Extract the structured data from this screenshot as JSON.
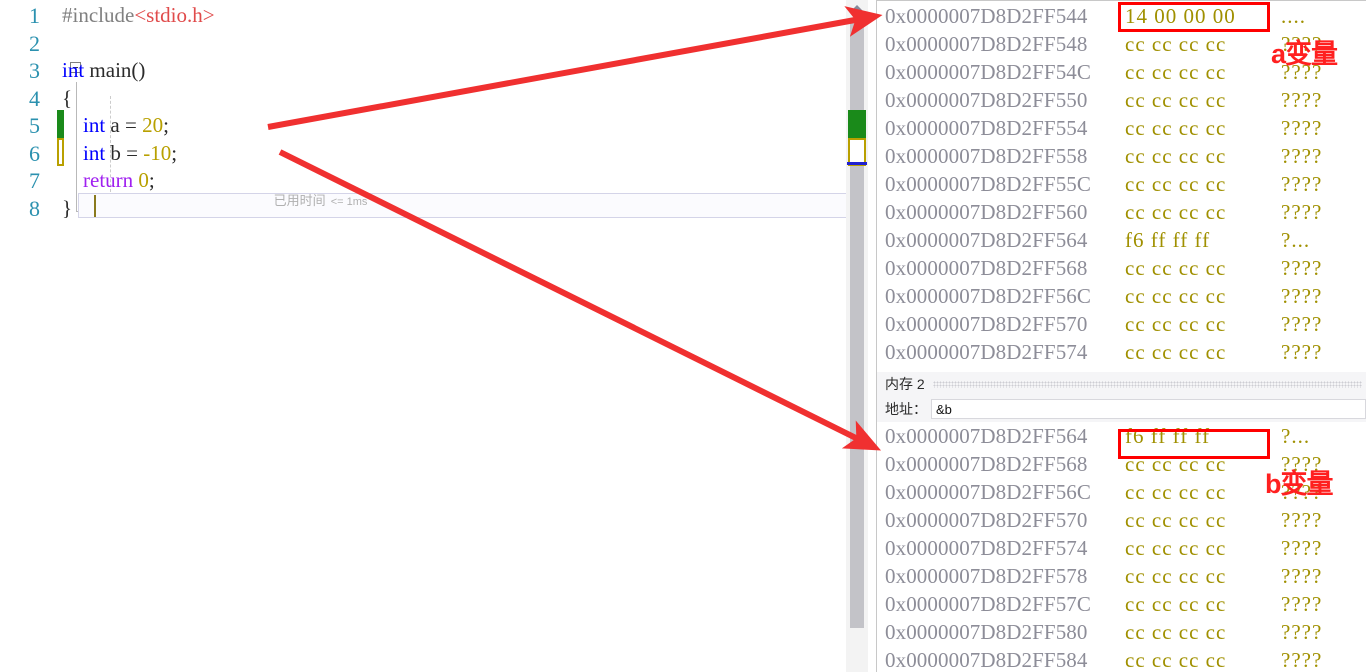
{
  "editor": {
    "elapsed_hint_zh": "已用时间",
    "elapsed_hint_en": "<= 1ms",
    "lines": [
      {
        "no": "1",
        "tokens": [
          {
            "t": "#include",
            "c": "pp"
          },
          {
            "t": "<stdio.h>",
            "c": "str"
          }
        ]
      },
      {
        "no": "2",
        "tokens": []
      },
      {
        "no": "3",
        "tokens": [
          {
            "t": "int",
            "c": "kw"
          },
          {
            "t": " ",
            "c": "plain"
          },
          {
            "t": "main",
            "c": "ident"
          },
          {
            "t": "()",
            "c": "punct"
          }
        ]
      },
      {
        "no": "4",
        "tokens": [
          {
            "t": "{",
            "c": "punct"
          }
        ]
      },
      {
        "no": "5",
        "tokens": [
          {
            "t": "    ",
            "c": "plain"
          },
          {
            "t": "int",
            "c": "kw"
          },
          {
            "t": " ",
            "c": "plain"
          },
          {
            "t": "a",
            "c": "ident"
          },
          {
            "t": " = ",
            "c": "punct"
          },
          {
            "t": "20",
            "c": "num"
          },
          {
            "t": ";",
            "c": "punct"
          }
        ]
      },
      {
        "no": "6",
        "tokens": [
          {
            "t": "    ",
            "c": "plain"
          },
          {
            "t": "int",
            "c": "kw"
          },
          {
            "t": " ",
            "c": "plain"
          },
          {
            "t": "b",
            "c": "ident"
          },
          {
            "t": " = ",
            "c": "punct"
          },
          {
            "t": "-10",
            "c": "num"
          },
          {
            "t": ";",
            "c": "punct"
          }
        ]
      },
      {
        "no": "7",
        "tokens": [
          {
            "t": "    ",
            "c": "plain"
          },
          {
            "t": "return",
            "c": "kw2"
          },
          {
            "t": " ",
            "c": "plain"
          },
          {
            "t": "0",
            "c": "num"
          },
          {
            "t": ";",
            "c": "punct"
          }
        ]
      },
      {
        "no": "8",
        "tokens": [
          {
            "t": "}",
            "c": "punct"
          }
        ]
      }
    ]
  },
  "memory_panel_1": {
    "rows": [
      {
        "addr": "0x0000007D8D2FF544",
        "hex": "14 00 00 00",
        "ascii": "...."
      },
      {
        "addr": "0x0000007D8D2FF548",
        "hex": "cc cc cc cc",
        "ascii": "????"
      },
      {
        "addr": "0x0000007D8D2FF54C",
        "hex": "cc cc cc cc",
        "ascii": "????"
      },
      {
        "addr": "0x0000007D8D2FF550",
        "hex": "cc cc cc cc",
        "ascii": "????"
      },
      {
        "addr": "0x0000007D8D2FF554",
        "hex": "cc cc cc cc",
        "ascii": "????"
      },
      {
        "addr": "0x0000007D8D2FF558",
        "hex": "cc cc cc cc",
        "ascii": "????"
      },
      {
        "addr": "0x0000007D8D2FF55C",
        "hex": "cc cc cc cc",
        "ascii": "????"
      },
      {
        "addr": "0x0000007D8D2FF560",
        "hex": "cc cc cc cc",
        "ascii": "????"
      },
      {
        "addr": "0x0000007D8D2FF564",
        "hex": "f6 ff ff ff",
        "ascii": "?..."
      },
      {
        "addr": "0x0000007D8D2FF568",
        "hex": "cc cc cc cc",
        "ascii": "????"
      },
      {
        "addr": "0x0000007D8D2FF56C",
        "hex": "cc cc cc cc",
        "ascii": "????"
      },
      {
        "addr": "0x0000007D8D2FF570",
        "hex": "cc cc cc cc",
        "ascii": "????"
      },
      {
        "addr": "0x0000007D8D2FF574",
        "hex": "cc cc cc cc",
        "ascii": "????"
      }
    ],
    "annotation": "a变量"
  },
  "memory_panel_2": {
    "title": "内存 2",
    "address_label": "地址：",
    "address_value": "&b",
    "rows": [
      {
        "addr": "0x0000007D8D2FF564",
        "hex": "f6 ff ff ff",
        "ascii": "?..."
      },
      {
        "addr": "0x0000007D8D2FF568",
        "hex": "cc cc cc cc",
        "ascii": "????"
      },
      {
        "addr": "0x0000007D8D2FF56C",
        "hex": "cc cc cc cc",
        "ascii": "????"
      },
      {
        "addr": "0x0000007D8D2FF570",
        "hex": "cc cc cc cc",
        "ascii": "????"
      },
      {
        "addr": "0x0000007D8D2FF574",
        "hex": "cc cc cc cc",
        "ascii": "????"
      },
      {
        "addr": "0x0000007D8D2FF578",
        "hex": "cc cc cc cc",
        "ascii": "????"
      },
      {
        "addr": "0x0000007D8D2FF57C",
        "hex": "cc cc cc cc",
        "ascii": "????"
      },
      {
        "addr": "0x0000007D8D2FF580",
        "hex": "cc cc cc cc",
        "ascii": "????"
      },
      {
        "addr": "0x0000007D8D2FF584",
        "hex": "cc cc cc cc",
        "ascii": "????"
      }
    ],
    "annotation": "b变量"
  },
  "colors": {
    "annotation_red": "#ff2020",
    "highlight_box_red": "#ff0000",
    "arrow_red": "#f03030",
    "hex_yellow": "#a09000",
    "address_gray": "#8d8d98",
    "keyword_blue": "#0000ff",
    "changebar_green": "#1a8a1a",
    "changebar_yellow": "#b9a000"
  }
}
